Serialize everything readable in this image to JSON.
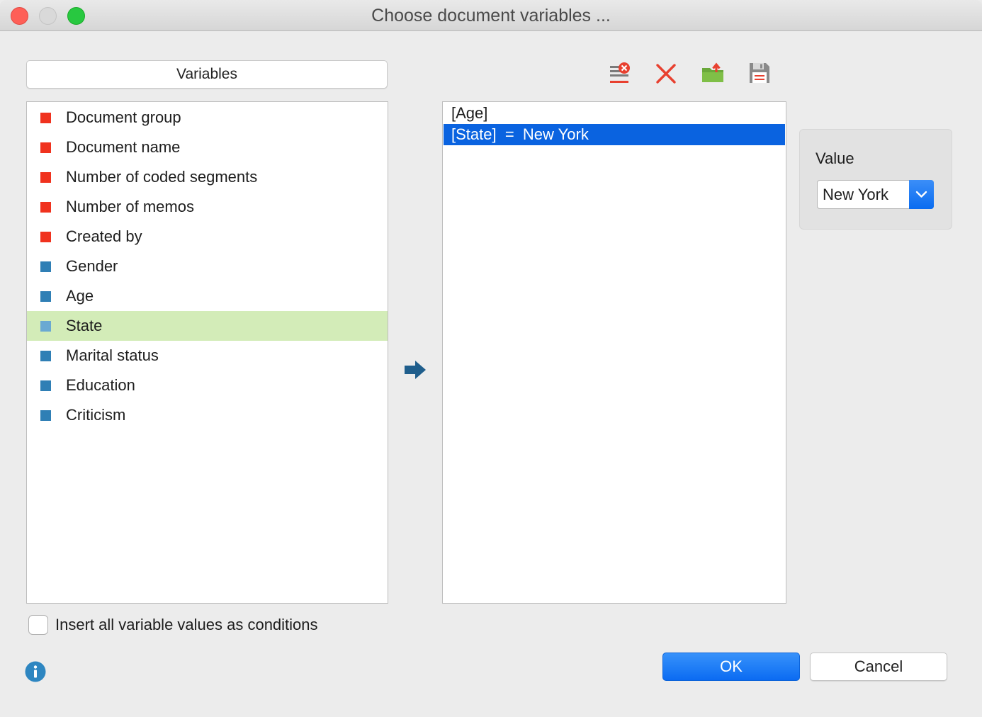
{
  "window": {
    "title": "Choose document variables ..."
  },
  "variables_header": "Variables",
  "variables": [
    {
      "label": "Document group",
      "kind": "system",
      "color": "#f0321e"
    },
    {
      "label": "Document name",
      "kind": "system",
      "color": "#f0321e"
    },
    {
      "label": "Number of coded segments",
      "kind": "system",
      "color": "#f0321e"
    },
    {
      "label": "Number of memos",
      "kind": "system",
      "color": "#f0321e"
    },
    {
      "label": "Created by",
      "kind": "system",
      "color": "#f0321e"
    },
    {
      "label": "Gender",
      "kind": "user",
      "color": "#2f7fb5"
    },
    {
      "label": "Age",
      "kind": "user",
      "color": "#2f7fb5"
    },
    {
      "label": "State",
      "kind": "user",
      "color": "#6aa9d2",
      "selected": true
    },
    {
      "label": "Marital status",
      "kind": "user",
      "color": "#2f7fb5"
    },
    {
      "label": "Education",
      "kind": "user",
      "color": "#2f7fb5"
    },
    {
      "label": "Criticism",
      "kind": "user",
      "color": "#2f7fb5"
    }
  ],
  "toolbar": {
    "icons": [
      "remove-all-conditions-icon",
      "delete-condition-icon",
      "open-filter-icon",
      "save-filter-icon"
    ]
  },
  "conditions": [
    {
      "text": "[Age]",
      "selected": false
    },
    {
      "text": "[State]  =  New York",
      "selected": true
    }
  ],
  "value_panel": {
    "label": "Value",
    "selected_value": "New York"
  },
  "checkbox": {
    "label": "Insert all variable values as conditions",
    "checked": false
  },
  "buttons": {
    "ok": "OK",
    "cancel": "Cancel"
  },
  "colors": {
    "selection_green": "#d3ecb8",
    "selection_blue": "#0a63e0",
    "accent": "#0b6bf2"
  }
}
